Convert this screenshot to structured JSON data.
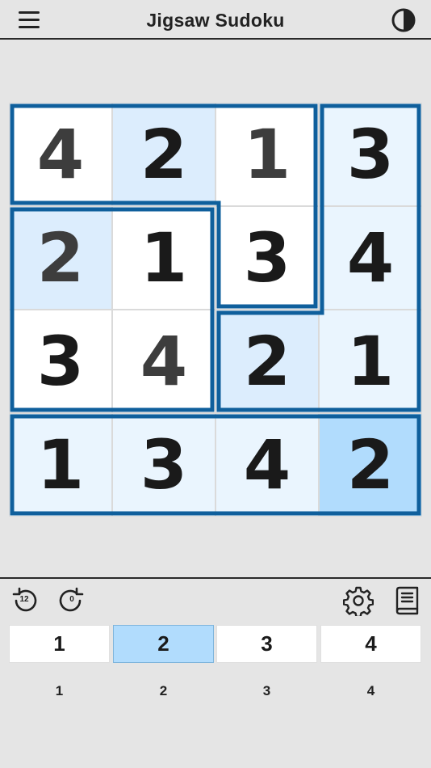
{
  "header": {
    "title": "Jigsaw Sudoku"
  },
  "icons": {
    "menu": "hamburger-menu-icon",
    "contrast": "contrast-icon",
    "undo": "undo-icon",
    "redo": "redo-icon",
    "settings": "gear-icon",
    "rules": "book-icon"
  },
  "colors": {
    "region_border": "#0f5f9c",
    "cell_white": "#ffffff",
    "cell_light_blue": "#eaf5fe",
    "cell_highlight": "#dcedfd",
    "cell_selected": "#b1dcfd",
    "key_selected": "#b1dcfd"
  },
  "board": {
    "size": 4,
    "cells": [
      {
        "row": 0,
        "col": 0,
        "value": "4",
        "given": true,
        "shade": "white"
      },
      {
        "row": 0,
        "col": 1,
        "value": "2",
        "given": false,
        "shade": "highlight"
      },
      {
        "row": 0,
        "col": 2,
        "value": "1",
        "given": true,
        "shade": "white"
      },
      {
        "row": 0,
        "col": 3,
        "value": "3",
        "given": false,
        "shade": "light_blue"
      },
      {
        "row": 1,
        "col": 0,
        "value": "2",
        "given": true,
        "shade": "highlight"
      },
      {
        "row": 1,
        "col": 1,
        "value": "1",
        "given": false,
        "shade": "white"
      },
      {
        "row": 1,
        "col": 2,
        "value": "3",
        "given": false,
        "shade": "white"
      },
      {
        "row": 1,
        "col": 3,
        "value": "4",
        "given": false,
        "shade": "light_blue"
      },
      {
        "row": 2,
        "col": 0,
        "value": "3",
        "given": false,
        "shade": "white"
      },
      {
        "row": 2,
        "col": 1,
        "value": "4",
        "given": true,
        "shade": "white"
      },
      {
        "row": 2,
        "col": 2,
        "value": "2",
        "given": false,
        "shade": "highlight"
      },
      {
        "row": 2,
        "col": 3,
        "value": "1",
        "given": false,
        "shade": "light_blue"
      },
      {
        "row": 3,
        "col": 0,
        "value": "1",
        "given": false,
        "shade": "light_blue"
      },
      {
        "row": 3,
        "col": 1,
        "value": "3",
        "given": false,
        "shade": "light_blue"
      },
      {
        "row": 3,
        "col": 2,
        "value": "4",
        "given": false,
        "shade": "light_blue"
      },
      {
        "row": 3,
        "col": 3,
        "value": "2",
        "given": false,
        "shade": "selected"
      }
    ],
    "regions": [
      [
        [
          0,
          0
        ],
        [
          0,
          1
        ],
        [
          0,
          2
        ],
        [
          1,
          2
        ]
      ],
      [
        [
          0,
          3
        ],
        [
          1,
          3
        ],
        [
          2,
          3
        ],
        [
          2,
          2
        ]
      ],
      [
        [
          1,
          0
        ],
        [
          1,
          1
        ],
        [
          2,
          0
        ],
        [
          2,
          1
        ]
      ],
      [
        [
          3,
          0
        ],
        [
          3,
          1
        ],
        [
          3,
          2
        ],
        [
          3,
          3
        ]
      ]
    ]
  },
  "toolbar": {
    "undo_count": "12",
    "redo_count": "0"
  },
  "keypad": {
    "keys": [
      "1",
      "2",
      "3",
      "4"
    ],
    "selected": "2",
    "counts": [
      "1",
      "2",
      "3",
      "4"
    ]
  }
}
